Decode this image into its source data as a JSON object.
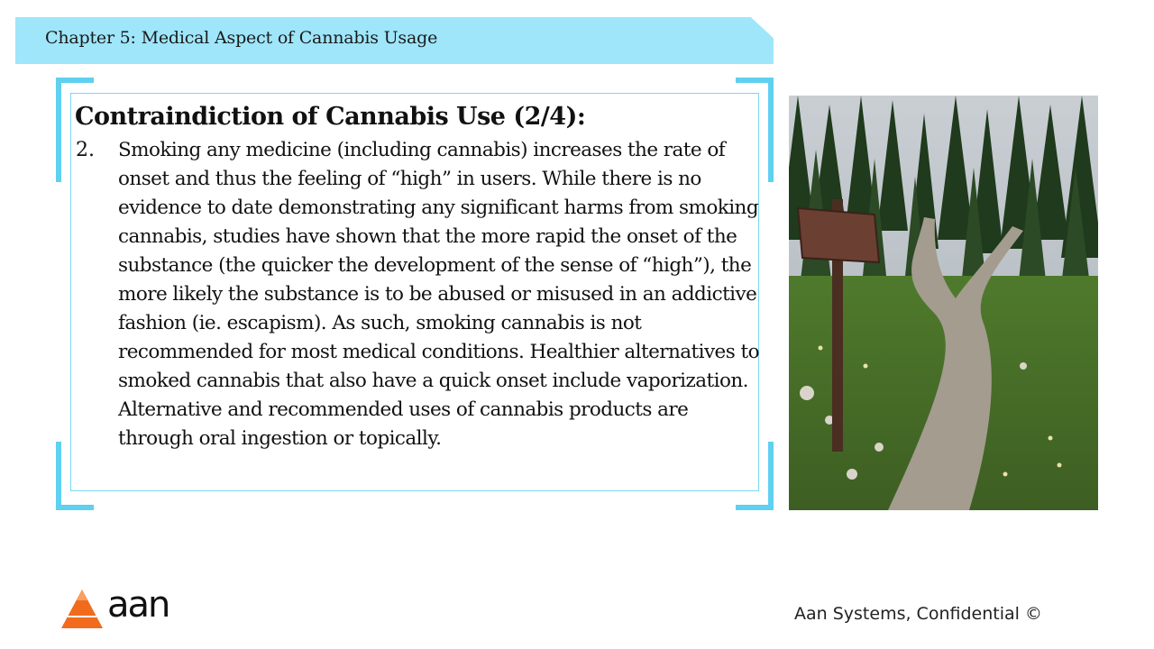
{
  "header": {
    "chapter_title": "Chapter 5: Medical Aspect of Cannabis Usage"
  },
  "content": {
    "heading": "Contraindiction of Cannabis Use (2/4):",
    "item_number": "2.",
    "item_text": "Smoking any medicine (including cannabis) increases the rate of onset and thus the feeling of “high” in users. While there is no evidence to date demonstrating any significant harms from smoking cannabis, studies have shown that the more rapid the onset of the substance (the quicker the development of the sense of “high”), the more likely the substance is to be abused or misused in an addictive fashion (ie. escapism). As such, smoking cannabis is not recommended for most medical conditions. Healthier alternatives to smoked cannabis that also have a quick onset include vaporization. Alternative and recommended uses of cannabis products are through oral ingestion or topically."
  },
  "footer": {
    "logo_text": "aan",
    "confidential": "Aan Systems, Confidential ©"
  },
  "colors": {
    "banner": "#9fe6fb",
    "frame": "#5fd0f0",
    "logo_orange": "#f26b1d"
  }
}
